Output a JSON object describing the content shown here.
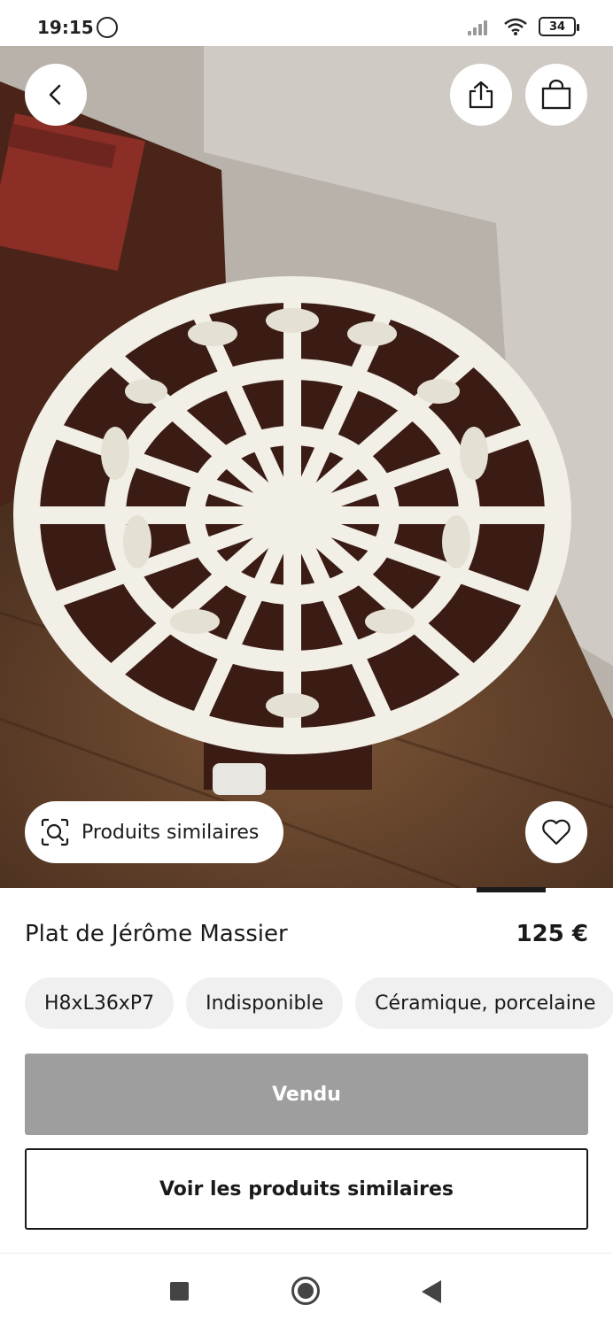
{
  "status_bar": {
    "time": "19:15",
    "battery_level": "34"
  },
  "hero": {
    "image_description_icon": "product-photo",
    "back_icon": "chevron-left-icon",
    "share_icon": "share-icon",
    "bag_icon": "shopping-bag-icon",
    "favorite_icon": "heart-icon",
    "similar_icon": "visual-search-icon",
    "similar_label": "Produits similaires"
  },
  "product": {
    "title": "Plat de Jérôme Massier",
    "price": "125 €",
    "chips": [
      "H8xL36xP7",
      "Indisponible",
      "Céramique, porcelaine"
    ]
  },
  "actions": {
    "sold_label": "Vendu",
    "similar_label": "Voir les produits similaires"
  },
  "colors": {
    "sold_button_bg": "#9e9e9e",
    "chip_bg": "#f0f0f0",
    "text": "#1a1a1a"
  }
}
